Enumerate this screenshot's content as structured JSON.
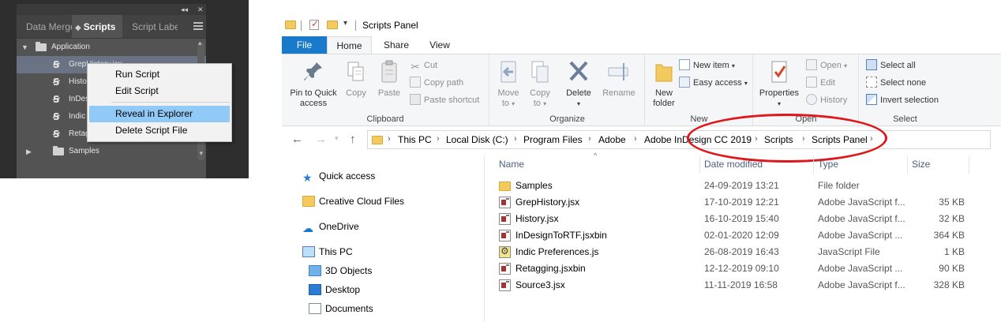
{
  "indesign": {
    "tabs": [
      "Data Merge",
      "Scripts",
      "Script Label"
    ],
    "tree": [
      {
        "label": "Application",
        "type": "folder",
        "expanded": true
      },
      {
        "label": "GrepHistory.jsx",
        "type": "script",
        "selected": true
      },
      {
        "label": "History.jsx",
        "type": "script"
      },
      {
        "label": "InDesignToRTF.jsxbin",
        "type": "script"
      },
      {
        "label": "Indic Preferences.js",
        "type": "script"
      },
      {
        "label": "Retagging.jsxbin",
        "type": "script"
      },
      {
        "label": "Samples",
        "type": "folder",
        "expanded": false
      }
    ],
    "context_menu": [
      "Run Script",
      "Edit Script",
      "Reveal in Explorer",
      "Delete Script File"
    ],
    "context_menu_highlighted": "Reveal in Explorer"
  },
  "explorer": {
    "window_title": "Scripts Panel",
    "ribbon_tabs": {
      "file": "File",
      "home": "Home",
      "share": "Share",
      "view": "View"
    },
    "ribbon": {
      "clipboard": {
        "label": "Clipboard",
        "pin_line1": "Pin to Quick",
        "pin_line2": "access",
        "copy": "Copy",
        "paste": "Paste",
        "cut": "Cut",
        "copy_path": "Copy path",
        "paste_shortcut": "Paste shortcut"
      },
      "organize": {
        "label": "Organize",
        "move_to_line1": "Move",
        "move_to_line2": "to",
        "copy_to_line1": "Copy",
        "copy_to_line2": "to",
        "delete": "Delete",
        "rename": "Rename"
      },
      "new": {
        "label": "New",
        "new_folder_line1": "New",
        "new_folder_line2": "folder",
        "new_item": "New item",
        "easy_access": "Easy access"
      },
      "open": {
        "label": "Open",
        "properties": "Properties",
        "open": "Open",
        "edit": "Edit",
        "history": "History"
      },
      "select": {
        "label": "Select",
        "select_all": "Select all",
        "select_none": "Select none",
        "invert_selection": "Invert selection"
      }
    },
    "breadcrumbs": [
      "This PC",
      "Local Disk (C:)",
      "Program Files",
      "Adobe",
      "Adobe InDesign CC 2019",
      "Scripts",
      "Scripts Panel"
    ],
    "nav_pane": {
      "quick_access": "Quick access",
      "creative_cloud": "Creative Cloud Files",
      "onedrive": "OneDrive",
      "this_pc": "This PC",
      "objects_3d": "3D Objects",
      "desktop": "Desktop",
      "documents": "Documents"
    },
    "columns": {
      "name": "Name",
      "date": "Date modified",
      "type": "Type",
      "size": "Size"
    },
    "files": [
      {
        "name": "Samples",
        "date": "24-09-2019 13:21",
        "type": "File folder",
        "size": "",
        "icon": "folder-icon"
      },
      {
        "name": "GrepHistory.jsx",
        "date": "17-10-2019 12:21",
        "type": "Adobe JavaScript f...",
        "size": "35 KB",
        "icon": "jsx-file-icon"
      },
      {
        "name": "History.jsx",
        "date": "16-10-2019 15:40",
        "type": "Adobe JavaScript f...",
        "size": "32 KB",
        "icon": "jsx-file-icon"
      },
      {
        "name": "InDesignToRTF.jsxbin",
        "date": "02-01-2020 12:09",
        "type": "Adobe JavaScript ...",
        "size": "364 KB",
        "icon": "jsx-file-icon"
      },
      {
        "name": "Indic Preferences.js",
        "date": "26-08-2019 16:43",
        "type": "JavaScript File",
        "size": "1 KB",
        "icon": "js-file-icon"
      },
      {
        "name": "Retagging.jsxbin",
        "date": "12-12-2019 09:10",
        "type": "Adobe JavaScript ...",
        "size": "90 KB",
        "icon": "jsx-file-icon"
      },
      {
        "name": "Source3.jsx",
        "date": "11-11-2019 16:58",
        "type": "Adobe JavaScript f...",
        "size": "328 KB",
        "icon": "jsx-file-icon"
      }
    ],
    "colors": {
      "accent": "#1979ca",
      "annotation": "#e0161a",
      "menu_highlight": "#91c9f7"
    }
  }
}
